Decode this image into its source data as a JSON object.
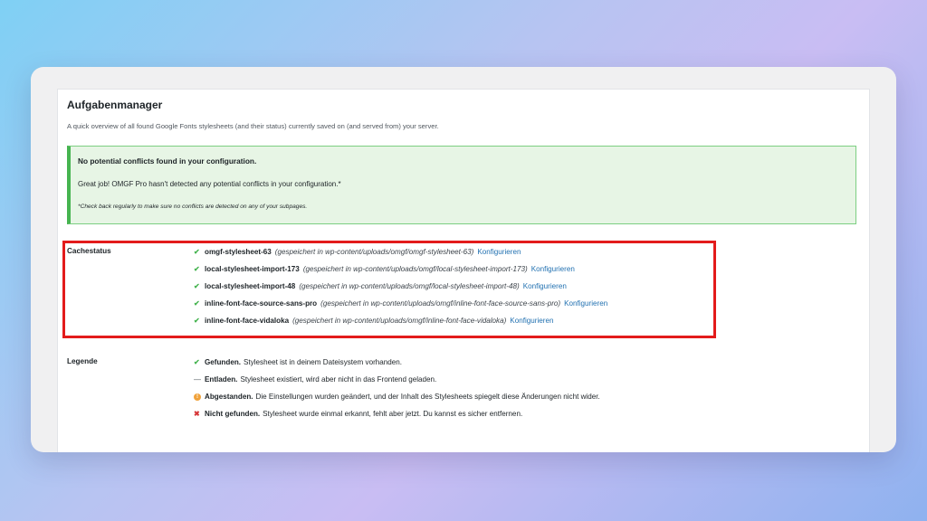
{
  "panel": {
    "title": "Aufgabenmanager",
    "description": "A quick overview of all found Google Fonts stylesheets (and their status) currently saved on (and served from) your server."
  },
  "notice": {
    "title": "No potential conflicts found in your configuration.",
    "body": "Great job! OMGF Pro hasn't detected any potential conflicts in your configuration.*",
    "note": "*Check back regularly to make sure no conflicts are detected on any of your subpages."
  },
  "cache": {
    "label": "Cachestatus",
    "items": [
      {
        "name": "omgf-stylesheet-63",
        "path": "(gespeichert in wp-content/uploads/omgf/omgf-stylesheet-63)",
        "link": "Konfigurieren"
      },
      {
        "name": "local-stylesheet-import-173",
        "path": "(gespeichert in wp-content/uploads/omgf/local-stylesheet-import-173)",
        "link": "Konfigurieren"
      },
      {
        "name": "local-stylesheet-import-48",
        "path": "(gespeichert in wp-content/uploads/omgf/local-stylesheet-import-48)",
        "link": "Konfigurieren"
      },
      {
        "name": "inline-font-face-source-sans-pro",
        "path": "(gespeichert in wp-content/uploads/omgf/inline-font-face-source-sans-pro)",
        "link": "Konfigurieren"
      },
      {
        "name": "inline-font-face-vidaloka",
        "path": "(gespeichert in wp-content/uploads/omgf/inline-font-face-vidaloka)",
        "link": "Konfigurieren"
      }
    ]
  },
  "legend": {
    "label": "Legende",
    "items": [
      {
        "icon": "check-icon",
        "term": "Gefunden.",
        "text": "Stylesheet ist in deinem Dateisystem vorhanden."
      },
      {
        "icon": "dash-icon",
        "term": "Entladen.",
        "text": "Stylesheet existiert, wird aber nicht in das Frontend geladen."
      },
      {
        "icon": "warning-icon",
        "term": "Abgestanden.",
        "text": "Die Einstellungen wurden geändert, und der Inhalt des Stylesheets spiegelt diese Änderungen nicht wider."
      },
      {
        "icon": "cross-icon",
        "term": "Nicht gefunden.",
        "text": "Stylesheet wurde einmal erkannt, fehlt aber jetzt. Du kannst es sicher entfernen."
      }
    ]
  },
  "colors": {
    "success": "#46b450",
    "highlight": "#e31b1b",
    "link": "#2271b1",
    "warning": "#f0a23b",
    "error": "#d63638"
  }
}
